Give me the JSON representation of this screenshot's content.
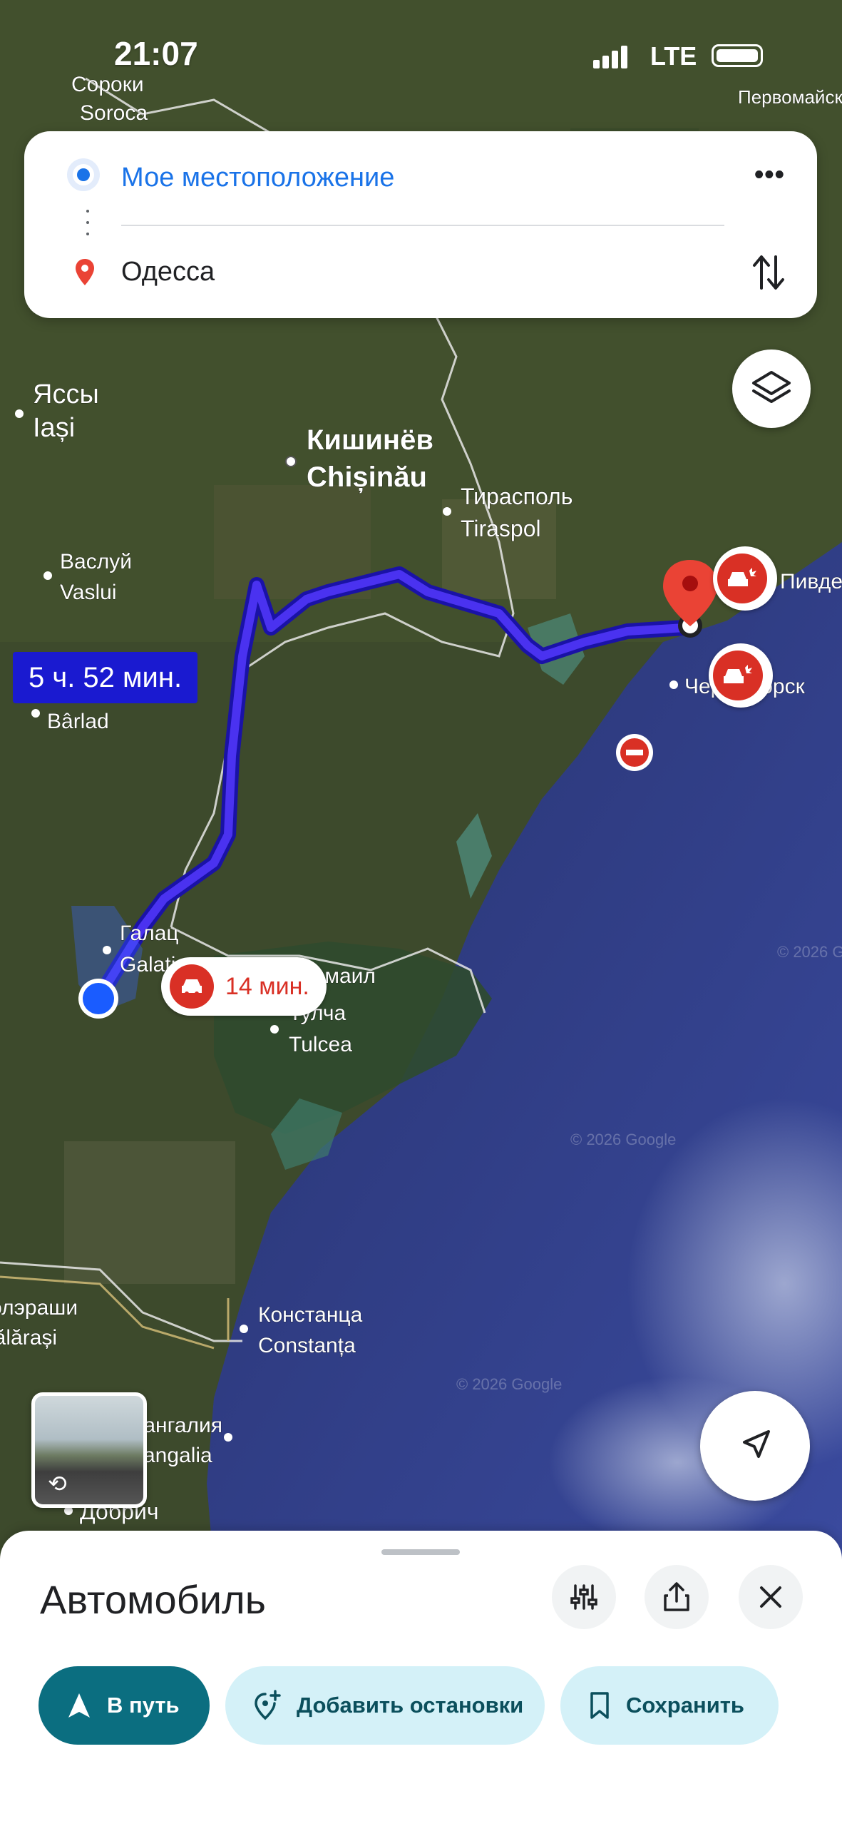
{
  "status_bar": {
    "time": "21:07",
    "network": "LTE"
  },
  "route": {
    "origin": "Мое местоположение",
    "destination": "Одесса",
    "duration_label": "5 ч. 52 мин.",
    "traffic_delay": "14 мин."
  },
  "map_labels": [
    {
      "id": "soroki",
      "lines": [
        "Сороки",
        "Soroca"
      ]
    },
    {
      "id": "iasi",
      "lines": [
        "Яссы",
        "Iași"
      ]
    },
    {
      "id": "chisinau",
      "lines": [
        "Кишинёв",
        "Chișinău"
      ]
    },
    {
      "id": "tiraspol",
      "lines": [
        "Тирасполь",
        "Tiraspol"
      ]
    },
    {
      "id": "vaslui",
      "lines": [
        "Васлуй",
        "Vaslui"
      ]
    },
    {
      "id": "barlad",
      "lines": [
        "Bârlad"
      ]
    },
    {
      "id": "galati",
      "lines": [
        "Галац",
        "Galați"
      ]
    },
    {
      "id": "ismail",
      "lines": [
        "Измаил"
      ]
    },
    {
      "id": "tulcea",
      "lines": [
        "Тулча",
        "Tulcea"
      ]
    },
    {
      "id": "constanta",
      "lines": [
        "Констанца",
        "Constanța"
      ]
    },
    {
      "id": "mangalia",
      "lines": [
        "Мангалия",
        "Mangalia"
      ]
    },
    {
      "id": "dobrich",
      "lines": [
        "Добрич"
      ]
    },
    {
      "id": "calarasi",
      "lines": [
        "Кэлэраши",
        "Călărași"
      ]
    },
    {
      "id": "pivdenne",
      "lines": [
        "Пивденне"
      ]
    },
    {
      "id": "chornomorsk",
      "lines": [
        "Черноморск"
      ]
    },
    {
      "id": "pervomaisk",
      "lines": [
        "Первомайск"
      ]
    }
  ],
  "watermark": "© 2026 Google",
  "bottom_sheet": {
    "title": "Автомобиль",
    "buttons": {
      "start": "В путь",
      "add_stops": "Добавить остановки",
      "save": "Сохранить"
    }
  },
  "colors": {
    "route": "#3b1fd9",
    "brand_blue": "#1a73e8",
    "alert_red": "#d93025",
    "primary_button": "#0b6e80",
    "tonal_button": "#d4f1f8"
  }
}
